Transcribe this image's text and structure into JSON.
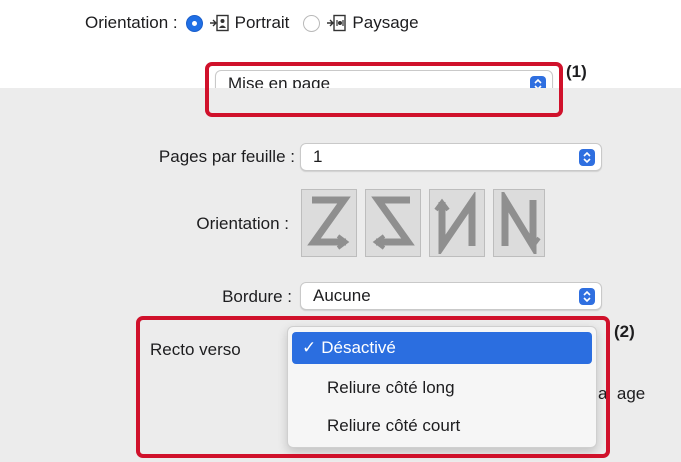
{
  "orientation": {
    "label": "Orientation :",
    "options": [
      {
        "label": "Portrait",
        "selected": true,
        "icon": "portrait-icon"
      },
      {
        "label": "Paysage",
        "selected": false,
        "icon": "landscape-icon"
      }
    ]
  },
  "section_popup": {
    "value": "Mise en page"
  },
  "pages_per_sheet": {
    "label": "Pages par feuille :",
    "value": "1"
  },
  "layout_direction": {
    "label": "Orientation :",
    "icons": [
      "layout-z-icon",
      "layout-reverse-z-icon",
      "layout-reverse-n-icon",
      "layout-n-icon"
    ]
  },
  "border": {
    "label": "Bordure :",
    "value": "Aucune"
  },
  "duplex": {
    "label": "Recto verso",
    "menu": [
      {
        "label": "Désactivé",
        "checkmark": "✓",
        "selected": true
      },
      {
        "label": "Reliure côté long",
        "selected": false
      },
      {
        "label": "Reliure côté court",
        "selected": false
      }
    ],
    "trailing_text_fragment": "a  age"
  },
  "callouts": {
    "one": "(1)",
    "two": "(2)"
  },
  "colors": {
    "accent": "#2b6ee0",
    "highlight": "#d0112b",
    "panel": "#ececec"
  }
}
